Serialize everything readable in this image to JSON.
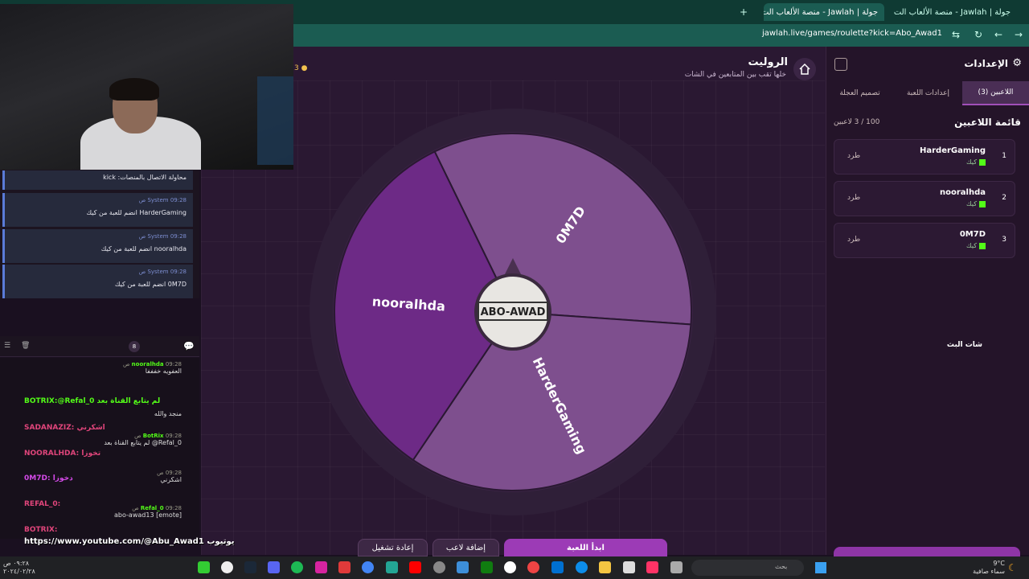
{
  "browser": {
    "tabs": [
      {
        "title": "جولة | Jawlah - منصة الألعاب الت",
        "active": false
      },
      {
        "title": "جولة | Jawlah - منصة الألعاب الت",
        "active": true
      }
    ],
    "url": "jawlah.live/games/roulette?kick=Abo_Awad1"
  },
  "header": {
    "title": "الروليت",
    "subtitle": "خلها تقب بين المتابعين في الشات",
    "coin": "3"
  },
  "settings": {
    "title": "الإعدادات",
    "tabs": [
      "اللاعبين (3)",
      "إعدادات اللعبة",
      "تصميم العجلة"
    ],
    "list_title": "قائمة اللاعبين",
    "list_count": "100 / 3 لاعبين",
    "players": [
      {
        "num": "1",
        "name": "HarderGaming",
        "source": "كيك",
        "kick": "طرد"
      },
      {
        "num": "2",
        "name": "nooralhda",
        "source": "كيك",
        "kick": "طرد"
      },
      {
        "num": "3",
        "name": "0M7D",
        "source": "كيك",
        "kick": "طرد"
      }
    ]
  },
  "wheel": {
    "segments": [
      {
        "label": "0M7D",
        "color": "#7e4f8e"
      },
      {
        "label": "HarderGaming",
        "color": "#7e4f8e"
      },
      {
        "label": "nooralhda",
        "color": "#6d2a86"
      }
    ],
    "logo": "ABO-AWAD"
  },
  "buttons": {
    "start": "ابدأ اللعبة",
    "add": "إضافة لاعب",
    "reset": "إعادة تشغيل"
  },
  "status_log": [
    {
      "text": "محاولة الاتصال بالمنصات: kick"
    },
    {
      "meta": "09:28 ص",
      "sender": "System",
      "text": "HarderGaming انضم للعبة من كيك"
    },
    {
      "meta": "09:28 ص",
      "sender": "System",
      "text": "nooralhda انضم للعبة من كيك"
    },
    {
      "meta": "09:28 ص",
      "sender": "System",
      "text": "0M7D انضم للعبة من كيك"
    }
  ],
  "chat": {
    "title": "شات البث",
    "count": "8",
    "messages": [
      {
        "user": "nooralhda",
        "time": "09:28 ص",
        "text": "العفويه خفففا"
      },
      {
        "user": "",
        "time": "",
        "text": "منجد والله"
      },
      {
        "user": "BotRix",
        "time": "09:28 ص",
        "text": "Refal_0@ لم يتابع القناة بعد"
      },
      {
        "user": "",
        "time": "09:28 ص",
        "text": "اشكرني"
      },
      {
        "user": "Refal_0",
        "time": "09:28 ص",
        "text": "[emote] abo-awad13"
      }
    ],
    "overlay": [
      {
        "text": "BOTRIX:@Refal_0 لم يتابع القناة بعد",
        "color": "#53fc18"
      },
      {
        "text": "SADANAZIZ: اشكرني",
        "color": "#e0457b"
      },
      {
        "text": "NOORALHDA: تخوزا",
        "color": "#e0457b"
      },
      {
        "text": "0M7D: دخوزا",
        "color": "#d44ae8"
      },
      {
        "text": "REFAL_0:",
        "color": "#e0457b"
      },
      {
        "text": "BOTRIX:",
        "color": "#e0457b"
      }
    ],
    "youtube": "https://www.youtube.com/@Abu_Awad1 يوتيوب"
  },
  "taskbar": {
    "search": "بحث",
    "weather_temp": "9°C",
    "weather_desc": "سماء صافية",
    "time": "٠٩:٢٨ ص",
    "date": "٢٠٢٤/٠٢/٢٨"
  }
}
